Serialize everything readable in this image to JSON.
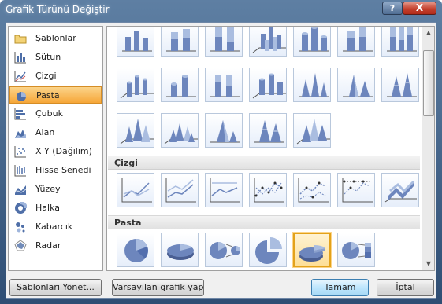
{
  "window": {
    "title": "Grafik Türünü Değiştir",
    "help_label": "?",
    "close_label": "X"
  },
  "categories": [
    {
      "label": "Şablonlar",
      "icon": "folder-icon",
      "selected": false
    },
    {
      "label": "Sütun",
      "icon": "column-chart-icon",
      "selected": false
    },
    {
      "label": "Çizgi",
      "icon": "line-chart-icon",
      "selected": false
    },
    {
      "label": "Pasta",
      "icon": "pie-chart-icon",
      "selected": true
    },
    {
      "label": "Çubuk",
      "icon": "bar-chart-icon",
      "selected": false
    },
    {
      "label": "Alan",
      "icon": "area-chart-icon",
      "selected": false
    },
    {
      "label": "X Y (Dağılım)",
      "icon": "scatter-chart-icon",
      "selected": false
    },
    {
      "label": "Hisse Senedi",
      "icon": "stock-chart-icon",
      "selected": false
    },
    {
      "label": "Yüzey",
      "icon": "surface-chart-icon",
      "selected": false
    },
    {
      "label": "Halka",
      "icon": "doughnut-chart-icon",
      "selected": false
    },
    {
      "label": "Kabarcık",
      "icon": "bubble-chart-icon",
      "selected": false
    },
    {
      "label": "Radar",
      "icon": "radar-chart-icon",
      "selected": false
    }
  ],
  "gallery": {
    "sections": {
      "line": "Çizgi",
      "pie": "Pasta"
    },
    "selected_chart": "exploded-pie-3d"
  },
  "buttons": {
    "manage_templates": "Şablonları Yönet...",
    "set_default": "Varsayılan grafik yap",
    "ok": "Tamam",
    "cancel": "İptal"
  },
  "colors": {
    "selection": "#f6a638",
    "chart_blue": "#6d86bd"
  }
}
